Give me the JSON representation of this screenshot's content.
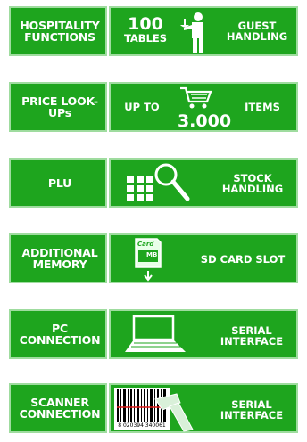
{
  "rows": [
    {
      "label": "HOSPITALITY FUNCTIONS",
      "num": "100",
      "num_unit": "TABLES",
      "right": "GUEST HANDLING",
      "icon": "waiter-icon"
    },
    {
      "label": "PRICE LOOK-UPs",
      "prefix": "UP TO",
      "num": "3.000",
      "right": "ITEMS",
      "icon": "shopping-cart-icon"
    },
    {
      "label": "PLU",
      "right": "STOCK HANDLING",
      "icon": "keypad-magnifier-icon"
    },
    {
      "label": "ADDITIONAL MEMORY",
      "card_top": "Card",
      "card_mid": "MB",
      "right": "SD CARD SLOT",
      "icon": "sd-card-icon"
    },
    {
      "label": "PC CONNECTION",
      "right": "SERIAL INTERFACE",
      "icon": "laptop-icon"
    },
    {
      "label": "SCANNER CONNECTION",
      "barcode_digits": "8 020394 340061",
      "right": "SERIAL INTERFACE",
      "icon": "barcode-scanner-icon"
    }
  ],
  "colors": {
    "green": "#1ea51e",
    "border": "#9fdc9f"
  }
}
